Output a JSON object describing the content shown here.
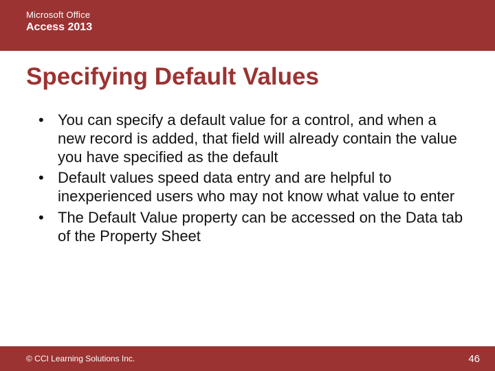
{
  "header": {
    "brand": "Microsoft Office",
    "product": "Access 2013"
  },
  "title": "Specifying Default Values",
  "bullets": [
    "You can specify a default value for a control, and when a new record is added, that field will already contain the value you have specified as the default",
    "Default values speed data entry and are helpful to inexperienced users who may not know what value to enter",
    "The Default Value property can be accessed on the Data tab of the Property Sheet"
  ],
  "footer": {
    "copyright": "© CCI Learning Solutions Inc.",
    "page": "46"
  }
}
